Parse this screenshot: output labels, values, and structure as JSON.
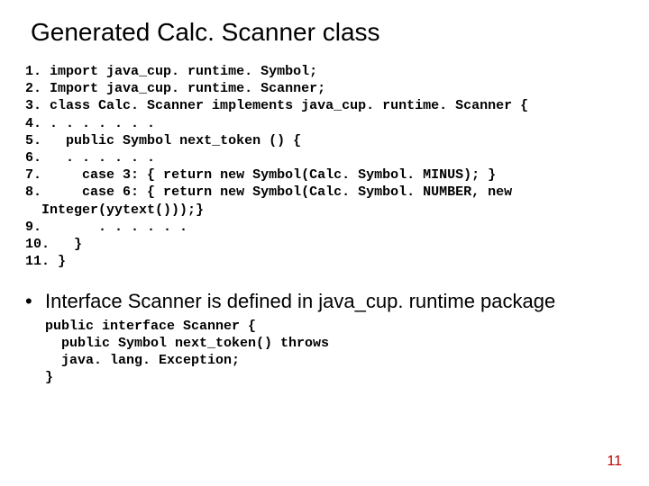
{
  "title": "Generated Calc. Scanner class",
  "code": {
    "lines": [
      {
        "n": "1.",
        "pre": "",
        "text": "import java_cup. runtime. Symbol;"
      },
      {
        "n": "2.",
        "pre": "",
        "text": "Import java_cup. runtime. Scanner;"
      },
      {
        "n": "3.",
        "pre": "",
        "text": "class Calc. Scanner implements java_cup. runtime. Scanner {"
      },
      {
        "n": "4.",
        "pre": "",
        "text": ". . . . . . ."
      },
      {
        "n": "5.",
        "pre": "  ",
        "text": "public Symbol next_token () {"
      },
      {
        "n": "6.",
        "pre": "  ",
        "text": ". . . . . ."
      },
      {
        "n": "7.",
        "pre": "    ",
        "text": "case 3: { return new Symbol(Calc. Symbol. MINUS); }"
      },
      {
        "n": "8.",
        "pre": "    ",
        "text": "case 6: { return new Symbol(Calc. Symbol. NUMBER, new"
      },
      {
        "n": "",
        "pre": "  ",
        "text": "Integer(yytext()));}"
      },
      {
        "n": "9.",
        "pre": "      ",
        "text": ". . . . . ."
      },
      {
        "n": "10.",
        "pre": "  ",
        "text": "}"
      },
      {
        "n": "11.",
        "pre": "",
        "text": "}"
      }
    ]
  },
  "bullet": "Interface Scanner is defined in java_cup. runtime package",
  "subcode": [
    "public interface Scanner {",
    "  public Symbol next_token() throws",
    "  java. lang. Exception;",
    "}"
  ],
  "pagenum": "11"
}
